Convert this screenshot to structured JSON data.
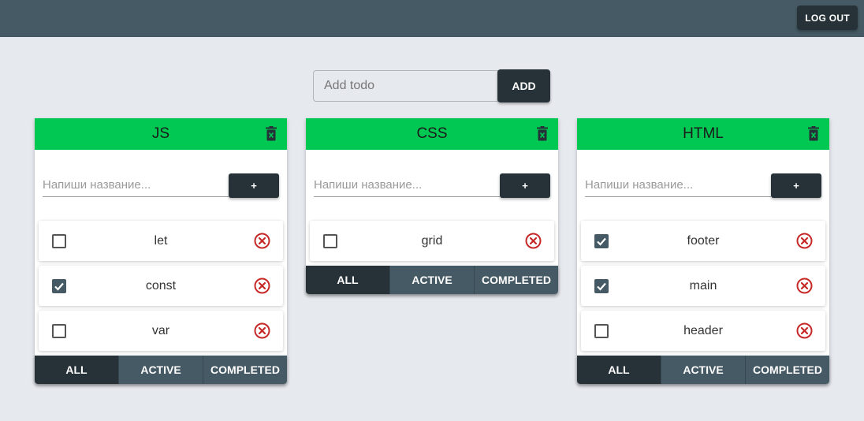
{
  "header": {
    "logout_label": "LOG OUT"
  },
  "add_todo": {
    "placeholder": "Add todo",
    "button_label": "ADD"
  },
  "lists": [
    {
      "title": "JS",
      "input_placeholder": "Напиши название...",
      "add_label": "+",
      "items": [
        {
          "text": "let",
          "checked": false
        },
        {
          "text": "const",
          "checked": true
        },
        {
          "text": "var",
          "checked": false
        }
      ],
      "filters": [
        "ALL",
        "ACTIVE",
        "COMPLETED"
      ],
      "active_filter": "ALL"
    },
    {
      "title": "CSS",
      "input_placeholder": "Напиши название...",
      "add_label": "+",
      "items": [
        {
          "text": "grid",
          "checked": false
        }
      ],
      "filters": [
        "ALL",
        "ACTIVE",
        "COMPLETED"
      ],
      "active_filter": "ALL"
    },
    {
      "title": "HTML",
      "input_placeholder": "Напиши название...",
      "add_label": "+",
      "items": [
        {
          "text": "footer",
          "checked": true
        },
        {
          "text": "main",
          "checked": true
        },
        {
          "text": "header",
          "checked": false
        }
      ],
      "filters": [
        "ALL",
        "ACTIVE",
        "COMPLETED"
      ],
      "active_filter": "ALL"
    }
  ],
  "colors": {
    "topbar": "#455a64",
    "card_header": "#00c853",
    "dark_button": "#263238",
    "filter_inactive": "#455a64",
    "delete_icon": "#c62828"
  },
  "icons": {
    "trash": "trash-icon",
    "delete": "close-circle-icon",
    "check": "check-icon"
  }
}
